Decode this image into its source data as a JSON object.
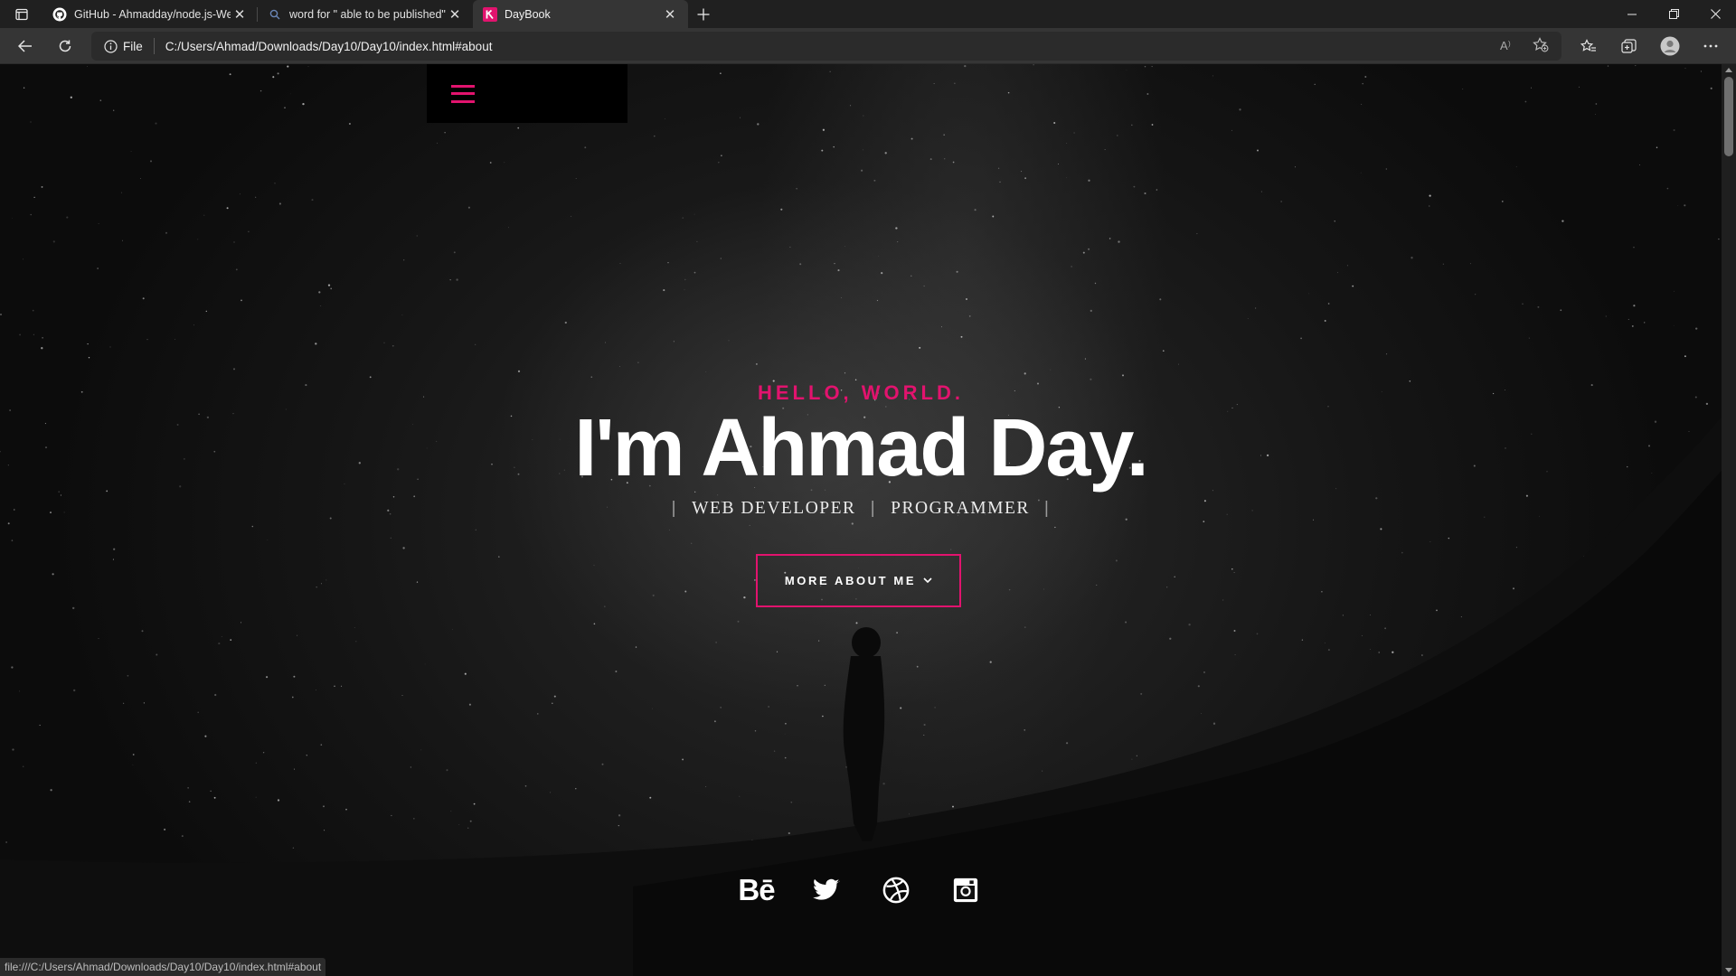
{
  "browser": {
    "tabs": [
      {
        "title": "GitHub - Ahmadday/node.js-We",
        "favicon": "github-icon",
        "active": false
      },
      {
        "title": "word for \" able to be published\"",
        "favicon": "search-icon",
        "active": false
      },
      {
        "title": "DayBook",
        "favicon": "k-logo-icon",
        "favicon_color": "#e2136e",
        "active": true
      }
    ],
    "address": {
      "security_label": "File",
      "url": "C:/Users/Ahmad/Downloads/Day10/Day10/index.html#about"
    },
    "status_url": "file:///C:/Users/Ahmad/Downloads/Day10/Day10/index.html#about"
  },
  "page": {
    "menu_icon": "hamburger-icon",
    "hello": "HELLO, WORLD.",
    "name": "I'm Ahmad Day.",
    "roles": [
      "WEB DEVELOPER",
      "PROGRAMMER"
    ],
    "cta": "MORE ABOUT ME",
    "socials": [
      "behance-icon",
      "twitter-icon",
      "dribbble-icon",
      "instagram-icon"
    ],
    "behance_label": "Bē",
    "colors": {
      "accent": "#e2136e",
      "menu_bg": "#000000",
      "text": "#ffffff"
    }
  }
}
